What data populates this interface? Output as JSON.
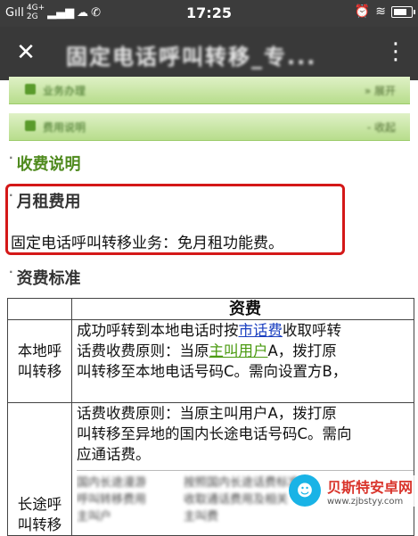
{
  "status_bar": {
    "signal1": "Gıll",
    "net_top": "4G+",
    "net_bottom": "2G",
    "time": "17:25"
  },
  "title_bar": {
    "title": "固定电话呼叫转移_专..."
  },
  "menu_rows": [
    {
      "label": "业务办理",
      "right": "» 展开"
    },
    {
      "label": "费用说明",
      "right": "- 收起"
    }
  ],
  "sections": {
    "fee_desc": "收费说明",
    "monthly_fee": "月租费用",
    "monthly_fee_text": "固定电话呼叫转移业务：免月租功能费。",
    "tariff": "资费标准"
  },
  "table": {
    "header": "资费",
    "local": {
      "label_l1": "本地呼",
      "label_l2": "叫转移",
      "line1_a": "成功呼转到本地电话时按",
      "line1_link": "市话费",
      "line1_b": "收取呼转",
      "line2_a": "话费收费原则：当原",
      "line2_link": "主叫用户",
      "line2_b": "A，拨打原",
      "line3": "叫转移至本地电话号码C。需向设置方B，"
    },
    "long": {
      "label_l1": "长途呼",
      "label_l2": "叫转移",
      "line1": "话费收费原则：当原主叫用户A，拨打原",
      "line2": "叫转移至异地的国内长途电话号码C。需向",
      "line3": "应通话费。",
      "blur_l1": "国内长途漫游",
      "blur_l2": "呼叫转移费用",
      "blur_l3": "主叫户",
      "blur_r1": "按照国内长途话费标准",
      "blur_r2": "收取通话费用及相关",
      "blur_r3": "主叫费"
    }
  },
  "watermark": {
    "name": "贝斯特安卓网",
    "url": "www.zjbstyy.com"
  }
}
